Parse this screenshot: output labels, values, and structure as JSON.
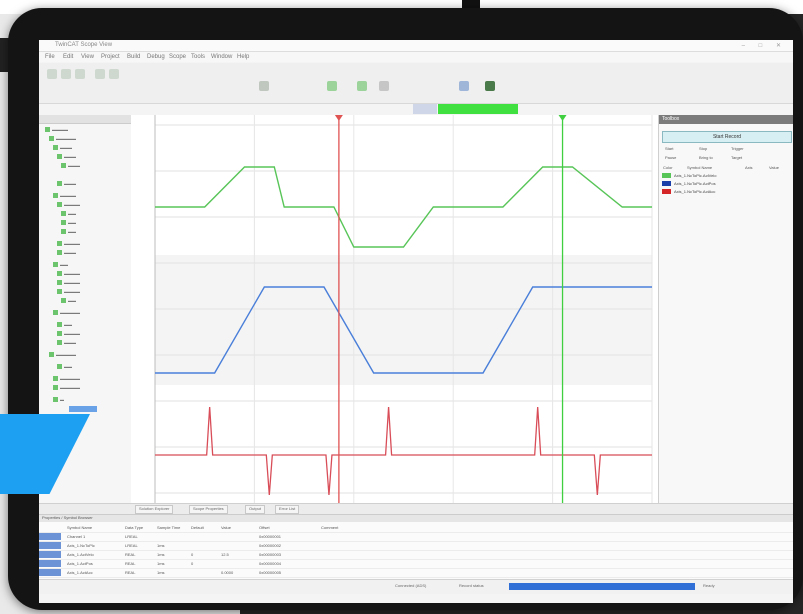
{
  "app": {
    "window_title": "TwinCAT Scope View"
  },
  "menu": [
    "File",
    "Edit",
    "View",
    "Project",
    "Build",
    "Debug",
    "Scope",
    "Tools",
    "Window",
    "Help"
  ],
  "right_panel": {
    "title": "Toolbox",
    "start_label": "Start Record",
    "rows": [
      "Start",
      "Stop",
      "Trigger",
      "Pause",
      "Bring to",
      "Target"
    ],
    "legend_header": [
      "Color",
      "Symbol Name",
      "Axis",
      "Value"
    ],
    "legend": [
      {
        "name": "Axis_1.NcToPlc.ActVelo",
        "color": "#58c558"
      },
      {
        "name": "Axis_1.NcToPlc.ActPos",
        "color": "#1b3fa8"
      },
      {
        "name": "Axis_1.NcToPlc.ActAcc",
        "color": "#d42626"
      }
    ]
  },
  "bottom_tabs": [
    "Solution Explorer",
    "Scope Properties",
    "Output",
    "Error List"
  ],
  "bottom_panel": {
    "header": "Properties / Symbol Browser",
    "columns": [
      "Symbol Name",
      "Data Type",
      "Sample Time",
      "Default",
      "Value",
      "Offset",
      "Comment"
    ],
    "rows": [
      [
        "Channel 1",
        "LREAL",
        "",
        "",
        "",
        "0x00000001",
        ""
      ],
      [
        "Axis_1.NcToPlc",
        "LREAL",
        "1ms",
        "",
        "",
        "0x00000002",
        ""
      ],
      [
        "Axis_1.ActVelo",
        "REAL",
        "1ms",
        "0",
        "12.5",
        "0x00000003",
        ""
      ],
      [
        "Axis_1.ActPos",
        "REAL",
        "1ms",
        "0",
        "",
        "0x00000004",
        ""
      ],
      [
        "Axis_1.ActAcc",
        "REAL",
        "1ms",
        "",
        "0.0000",
        "0x00000005",
        ""
      ]
    ]
  },
  "status": {
    "left_text": "Connected (ADS)",
    "middle_text": "Record status",
    "right_text": "Ready"
  },
  "chart_data": {
    "type": "line",
    "x": [
      0,
      10,
      18,
      24,
      26,
      36,
      40,
      50,
      56,
      70,
      78,
      84,
      94,
      100
    ],
    "series": [
      {
        "name": "Axis_1.NcToPlc.ActVelo",
        "color": "#58c558",
        "values": [
          0,
          0,
          1,
          1,
          0,
          0,
          -1,
          -1,
          0,
          0,
          1,
          1,
          0,
          0
        ]
      }
    ],
    "cursor_red_x": 37,
    "cursor_green_x": 82
  }
}
